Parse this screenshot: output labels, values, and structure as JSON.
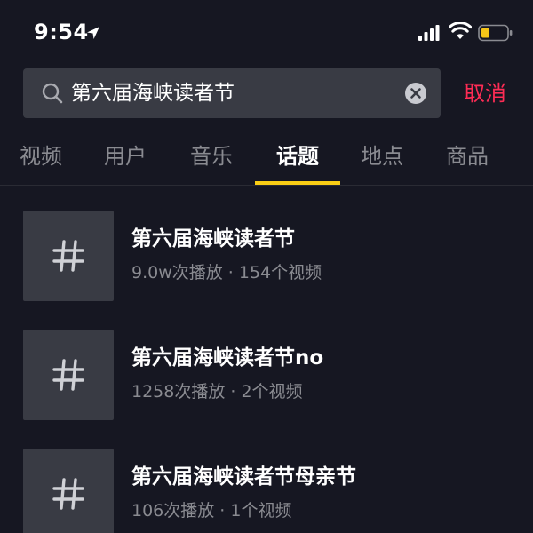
{
  "status_bar": {
    "time": "9:54",
    "icons": [
      "location-arrow-icon",
      "cellular-signal-icon",
      "wifi-icon",
      "battery-icon"
    ],
    "battery_color": "#f5c518"
  },
  "search": {
    "query": "第六届海峡读者节",
    "cancel_label": "取消",
    "icons": [
      "search-icon",
      "clear-icon"
    ]
  },
  "tabs": [
    {
      "label": "视频",
      "active": false
    },
    {
      "label": "用户",
      "active": false
    },
    {
      "label": "音乐",
      "active": false
    },
    {
      "label": "话题",
      "active": true
    },
    {
      "label": "地点",
      "active": false
    },
    {
      "label": "商品",
      "active": false
    }
  ],
  "topics": [
    {
      "title": "第六届海峡读者节",
      "meta": "9.0w次播放 · 154个视频",
      "icon": "hashtag-icon"
    },
    {
      "title": "第六届海峡读者节no",
      "meta": "1258次播放 · 2个视频",
      "icon": "hashtag-icon"
    },
    {
      "title": "第六届海峡读者节母亲节",
      "meta": "106次播放 · 1个视频",
      "icon": "hashtag-icon"
    }
  ],
  "colors": {
    "background": "#161722",
    "accent_red": "#fe2c55",
    "tab_indicator": "#face15",
    "muted_text": "#8a8b91",
    "surface": "#393b44"
  }
}
